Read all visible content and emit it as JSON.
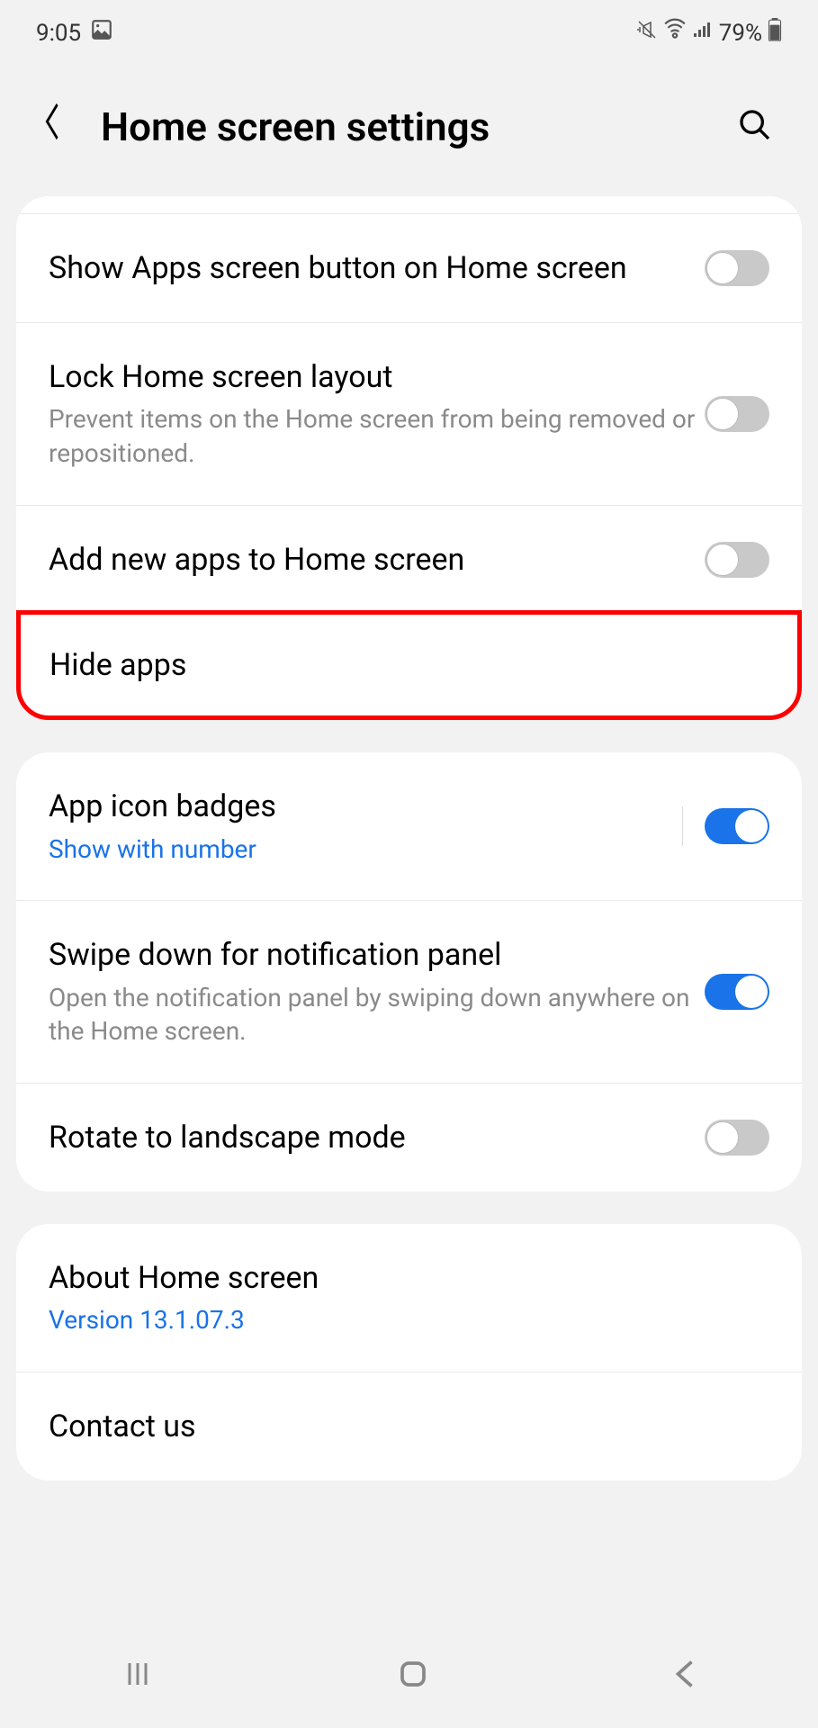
{
  "statusBar": {
    "time": "9:05",
    "battery": "79%"
  },
  "header": {
    "title": "Home screen settings"
  },
  "section1": {
    "items": [
      {
        "title": "Show Apps screen button on Home screen",
        "toggle": false
      },
      {
        "title": "Lock Home screen layout",
        "subtitle": "Prevent items on the Home screen from being removed or repositioned.",
        "toggle": false
      },
      {
        "title": "Add new apps to Home screen",
        "toggle": false
      },
      {
        "title": "Hide apps",
        "highlighted": true
      }
    ]
  },
  "section2": {
    "items": [
      {
        "title": "App icon badges",
        "subtitle": "Show with number",
        "subtitleBlue": true,
        "toggle": true,
        "hasDivider": true
      },
      {
        "title": "Swipe down for notification panel",
        "subtitle": "Open the notification panel by swiping down anywhere on the Home screen.",
        "toggle": true
      },
      {
        "title": "Rotate to landscape mode",
        "toggle": false
      }
    ]
  },
  "section3": {
    "items": [
      {
        "title": "About Home screen",
        "subtitle": "Version 13.1.07.3",
        "subtitleBlue": true
      },
      {
        "title": "Contact us"
      }
    ]
  }
}
